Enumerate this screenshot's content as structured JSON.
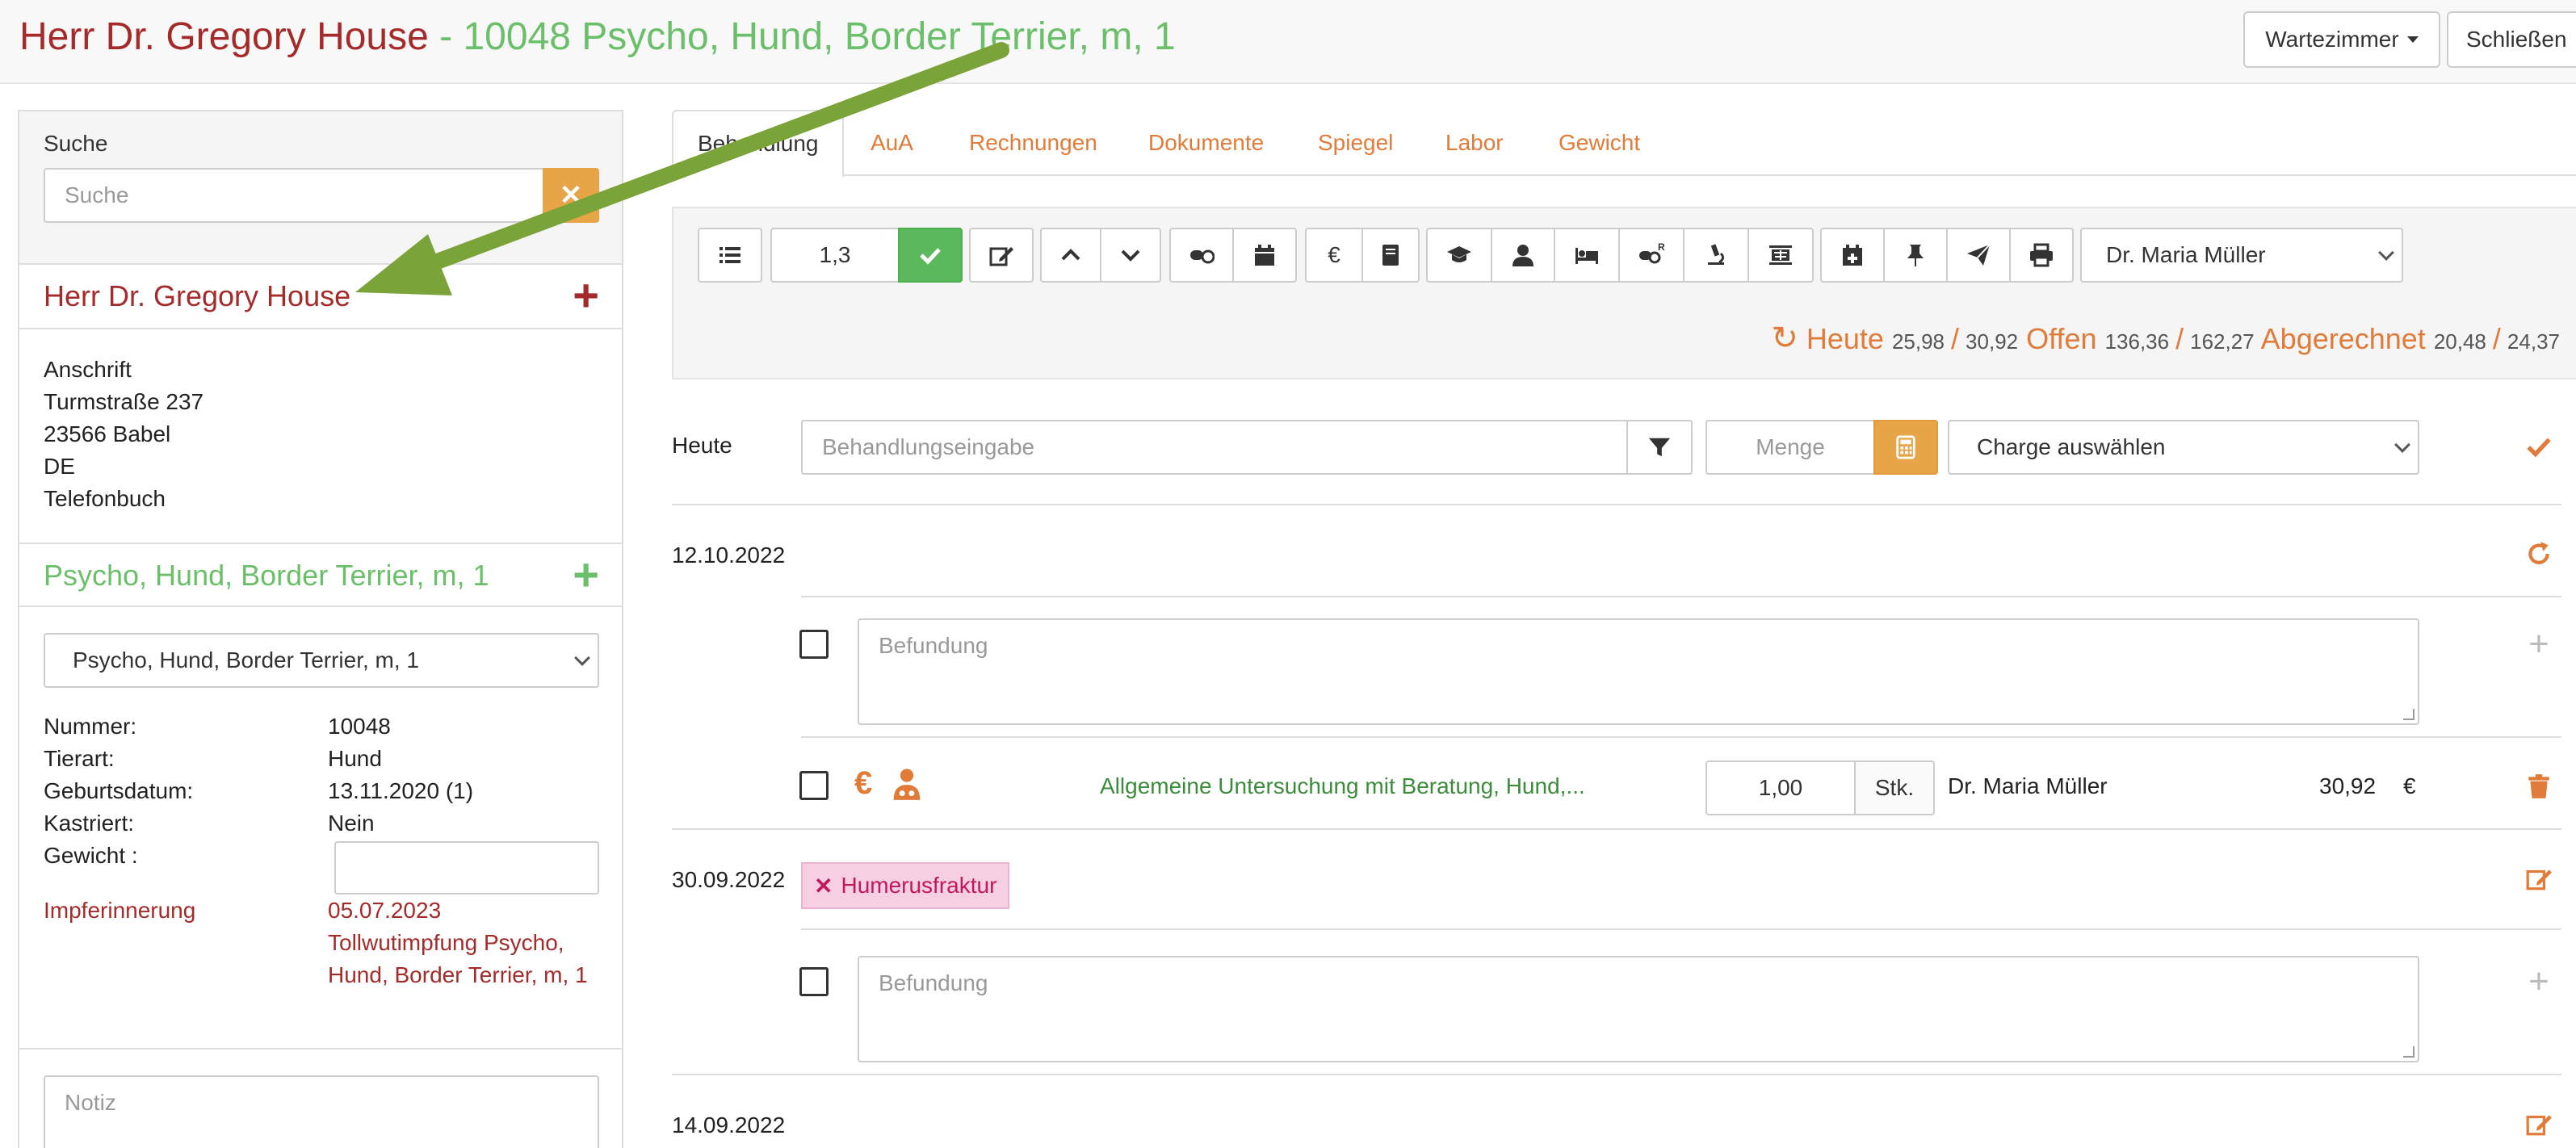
{
  "header": {
    "owner_title": "Herr Dr. Gregory House",
    "patient_title": " - 10048 Psycho, Hund, Border Terrier, m, 1",
    "waiting_room_label": "Wartezimmer",
    "close_label": "Schließen"
  },
  "search": {
    "label": "Suche",
    "placeholder": "Suche",
    "clear_icon": "times-icon"
  },
  "owner": {
    "name": "Herr Dr. Gregory House",
    "address_label": "Anschrift",
    "street": "Turmstraße 237",
    "city": "23566  Babel",
    "country": "DE",
    "phonebook": "Telefonbuch"
  },
  "patient": {
    "name": "Psycho, Hund, Border Terrier, m, 1",
    "select_value": "Psycho, Hund, Border Terrier, m, 1",
    "fields": [
      {
        "label": "Nummer:",
        "value": "10048"
      },
      {
        "label": "Tierart:",
        "value": "Hund"
      },
      {
        "label": "Geburtsdatum:",
        "value": "13.11.2020  (1)"
      },
      {
        "label": "Kastriert:",
        "value": "Nein"
      },
      {
        "label": "Gewicht :",
        "value": ""
      }
    ],
    "vaccination_label": "Impferinnerung",
    "vaccination_date": "05.07.2023",
    "vaccination_text_1": "Tollwutimpfung Psycho,",
    "vaccination_text_2": "Hund, Border Terrier, m, 1",
    "note_placeholder": "Notiz"
  },
  "tabs": [
    {
      "label": "Behandlung",
      "active": true
    },
    {
      "label": "AuA"
    },
    {
      "label": "Rechnungen"
    },
    {
      "label": "Dokumente"
    },
    {
      "label": "Spiegel"
    },
    {
      "label": "Labor"
    },
    {
      "label": "Gewicht"
    }
  ],
  "toolbar": {
    "factor": "1,3",
    "doctor": "Dr. Maria Müller",
    "icons": [
      "list-icon",
      "check-icon",
      "edit-icon",
      "chevron-up-icon",
      "chevron-down-icon",
      "pills-icon",
      "calendar-icon",
      "euro-icon",
      "book-icon",
      "graduation-cap-icon",
      "user-icon",
      "bed-icon",
      "prescription-icon",
      "microscope-icon",
      "xray-icon",
      "calendar-plus-icon",
      "pin-icon",
      "send-icon",
      "print-icon"
    ]
  },
  "summary": {
    "today_label": "Heute",
    "today_a": "25,98",
    "today_b": "30,92",
    "open_label": "Offen",
    "open_a": "136,36",
    "open_b": "162,27",
    "billed_label": "Abgerechnet",
    "billed_a": "20,48",
    "billed_b": "24,37",
    "sep": "/"
  },
  "entry": {
    "date_label": "Heute",
    "treatment_placeholder": "Behandlungseingabe",
    "quantity_placeholder": "Menge",
    "charge_value": "Charge auswählen"
  },
  "records": [
    {
      "date": "12.10.2022",
      "findings_placeholder": "Befundung"
    },
    {
      "date": "30.09.2022",
      "diagnosis": "Humerusfraktur",
      "findings_placeholder": "Befundung"
    },
    {
      "date": "14.09.2022"
    }
  ],
  "line_item": {
    "description": "Allgemeine Untersuchung mit Beratung, Hund,...",
    "quantity": "1,00",
    "unit": "Stk.",
    "doctor": "Dr. Maria Müller",
    "price": "30,92",
    "currency": "€",
    "euro_symbol": "€"
  },
  "colors": {
    "owner": "#a52a2a",
    "patient": "#6cbf6a",
    "accent": "#e07b39",
    "success": "#5cb85c",
    "annotation_arrow": "#7aa33a"
  }
}
